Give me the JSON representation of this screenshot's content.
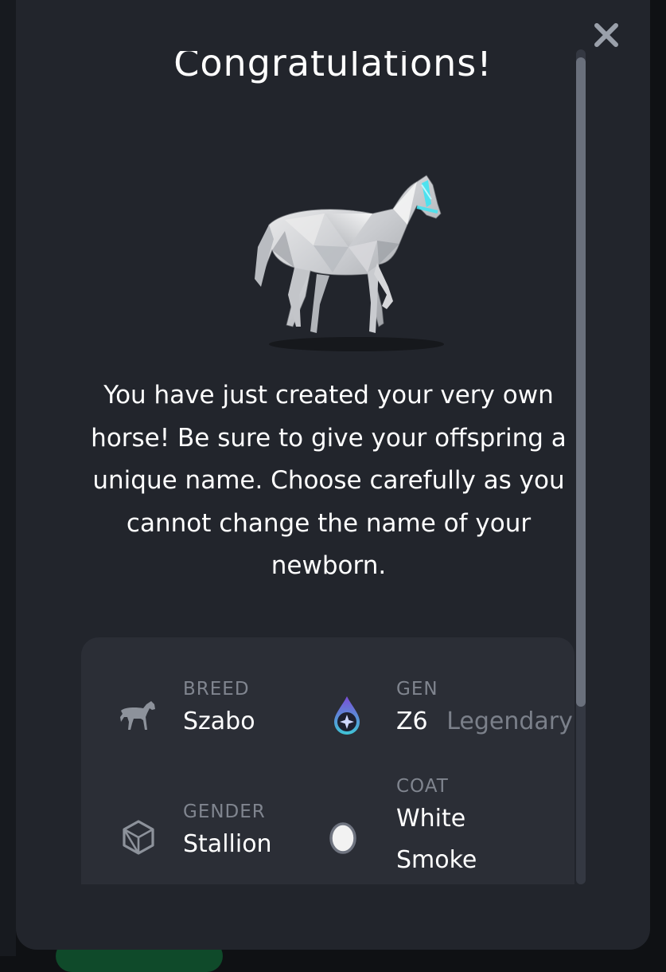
{
  "modal": {
    "title": "Congratulations!",
    "description": "You have just created your very own horse! Be sure to give your offspring a unique name. Choose carefully as you cannot change the name of your newborn."
  },
  "traits": {
    "breed": {
      "label": "BREED",
      "value": "Szabo",
      "icon": "horse-icon"
    },
    "gen": {
      "label": "GEN",
      "value": "Z6",
      "tier": "Legendary",
      "icon": "drop-star-icon"
    },
    "gender": {
      "label": "GENDER",
      "value": "Stallion",
      "icon": "cube-icon"
    },
    "coat": {
      "label": "COAT",
      "value_line1": "White",
      "value_line2": "Smoke",
      "icon": "color-dot-icon",
      "color": "#f2f2f2"
    }
  },
  "colors": {
    "modal_bg": "#22252c",
    "card_bg": "#2b2e36",
    "accent_glow": "#47e3f0",
    "gen_gradient_top": "#7b4dd8",
    "gen_gradient_bottom": "#3fc5d6"
  }
}
